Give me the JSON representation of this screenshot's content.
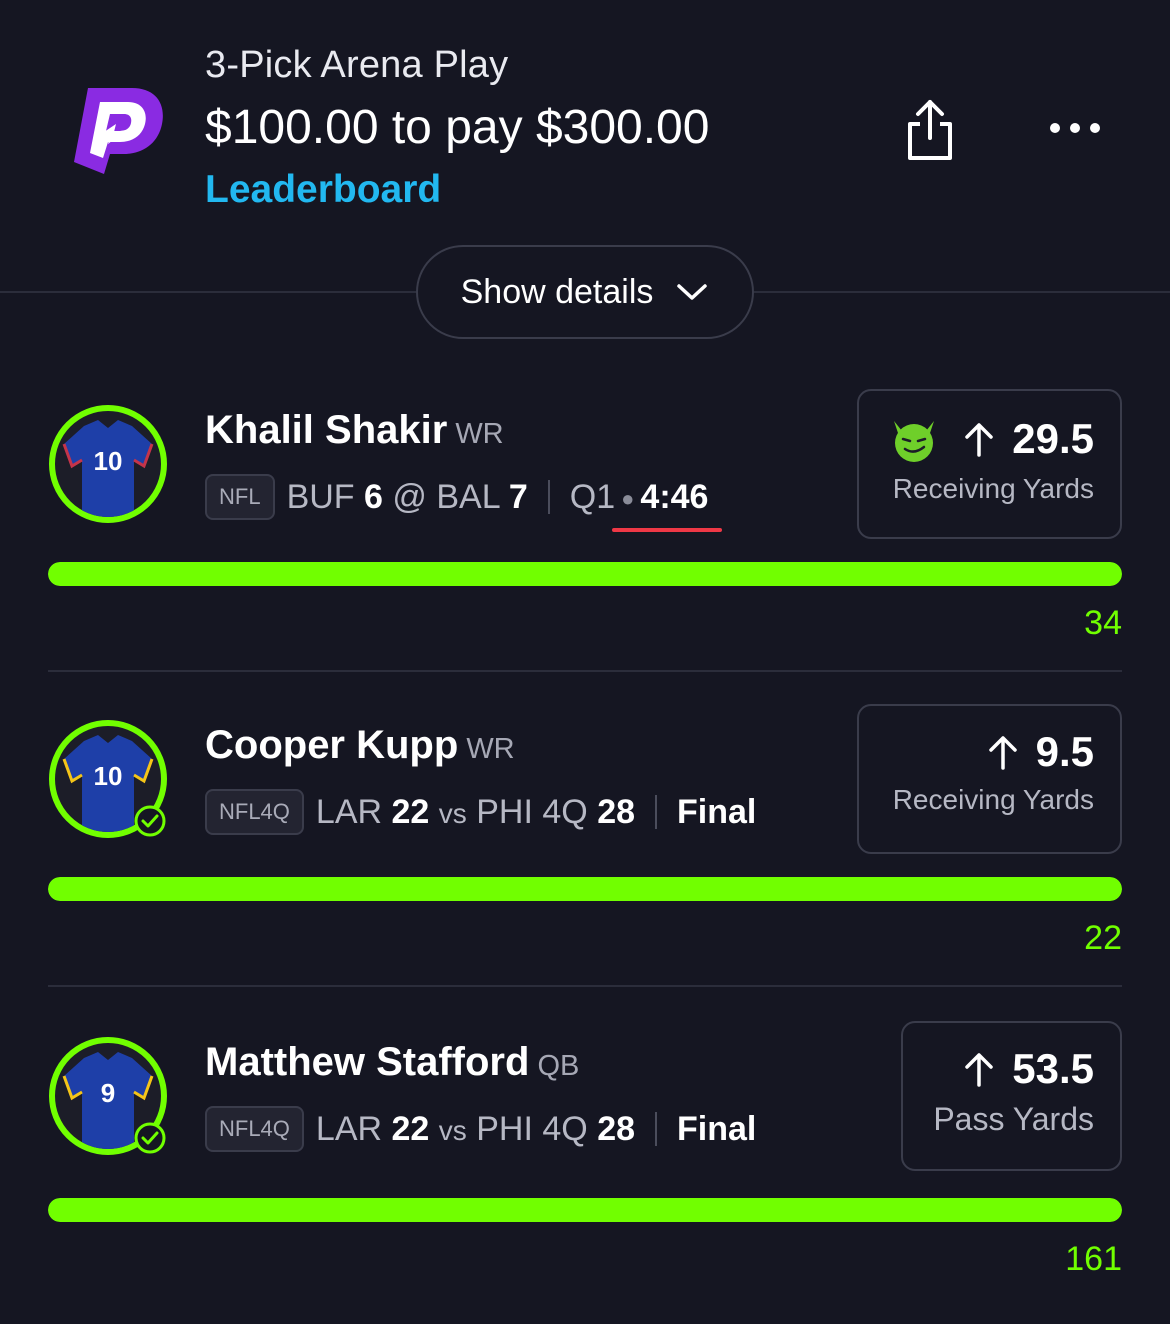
{
  "header": {
    "title": "3-Pick Arena Play",
    "subtitle": "$100.00 to pay $300.00",
    "leaderboard_label": "Leaderboard",
    "logo_icon": "prizepicks-logo-icon",
    "share_icon": "share-icon",
    "more_icon": "more-icon"
  },
  "show_details_label": "Show details",
  "colors": {
    "background": "#151622",
    "accent_green": "#71ff00",
    "link_blue": "#22b8f0",
    "clock_underline": "#ef3846",
    "logo_purple": "#8a2be2",
    "jersey_blue": "#1e3fa8"
  },
  "picks": [
    {
      "player": "Khalil Shakir",
      "position": "WR",
      "jersey_number": "10",
      "league": "NFL",
      "away_team": "BUF",
      "away_score": "6",
      "separator": "@",
      "home_team": "BAL",
      "home_score": "7",
      "period": "Q1",
      "clock": "4:46",
      "status": "live",
      "line_direction": "More",
      "line_value": "29.5",
      "stat": "Receiving Yards",
      "demon_icon": true,
      "actual": "34",
      "progress_fraction": 1.0,
      "completed": false
    },
    {
      "player": "Cooper Kupp",
      "position": "WR",
      "jersey_number": "10",
      "league": "NFL4Q",
      "away_team": "LAR",
      "away_score": "22",
      "separator": "vs",
      "home_team": "PHI 4Q",
      "home_score": "28",
      "status_label": "Final",
      "status": "final",
      "line_direction": "More",
      "line_value": "9.5",
      "stat": "Receiving Yards",
      "demon_icon": false,
      "actual": "22",
      "progress_fraction": 1.0,
      "completed": true
    },
    {
      "player": "Matthew Stafford",
      "position": "QB",
      "jersey_number": "9",
      "league": "NFL4Q",
      "away_team": "LAR",
      "away_score": "22",
      "separator": "vs",
      "home_team": "PHI 4Q",
      "home_score": "28",
      "status_label": "Final",
      "status": "final",
      "line_direction": "More",
      "line_value": "53.5",
      "stat": "Pass Yards",
      "demon_icon": false,
      "actual": "161",
      "progress_fraction": 1.0,
      "completed": true
    }
  ]
}
